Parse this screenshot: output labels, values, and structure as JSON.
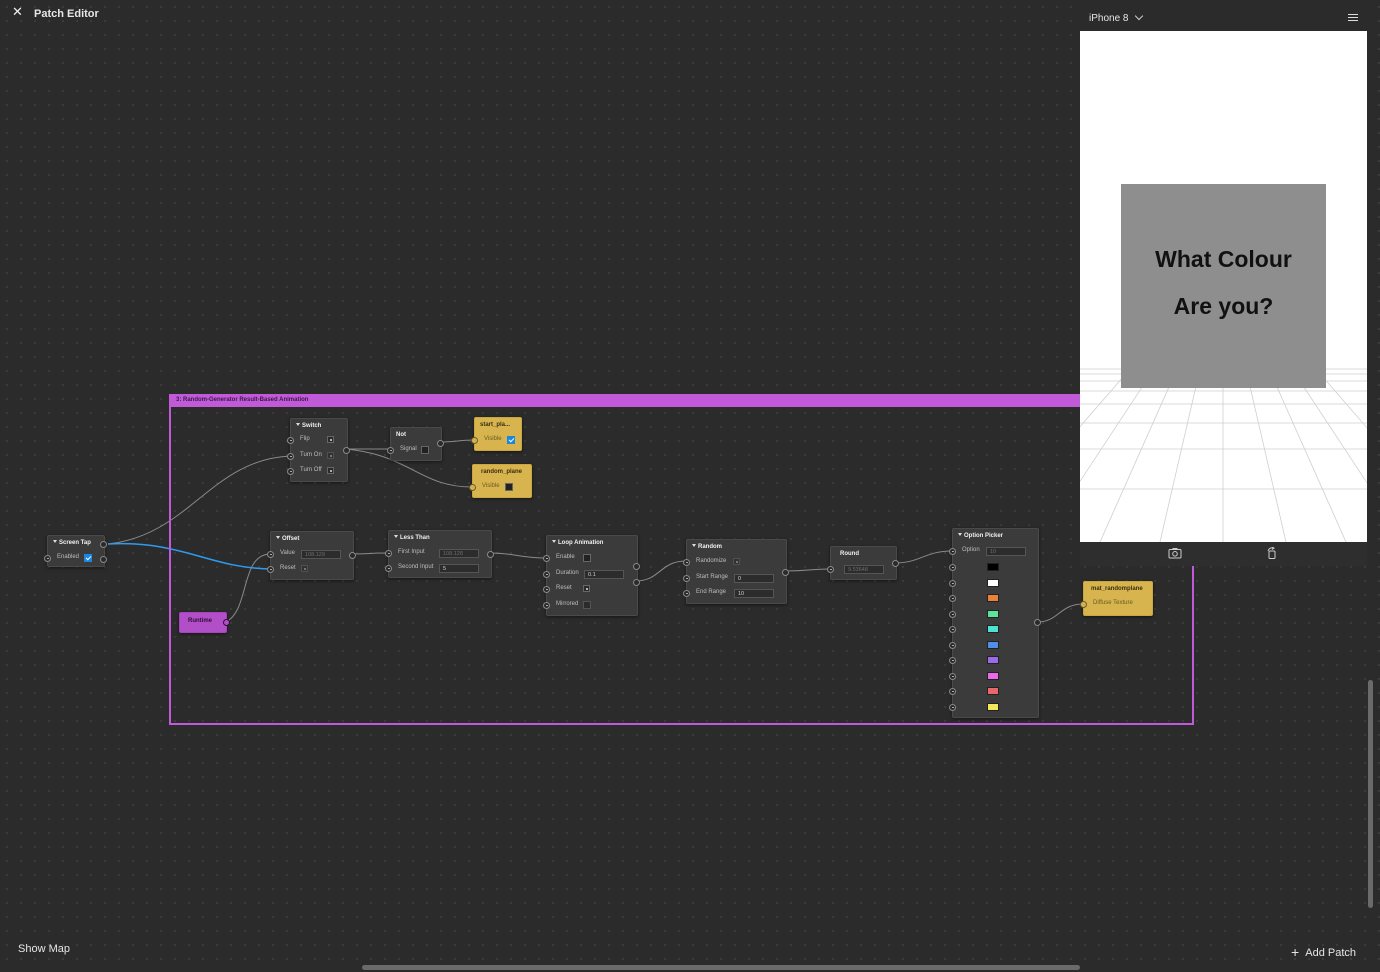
{
  "header": {
    "close_icon": "close-icon",
    "title": "Patch Editor"
  },
  "footer": {
    "show_map": "Show Map",
    "add_patch": "Add Patch"
  },
  "group": {
    "title": "3: Random-Generator Result-Based Animation",
    "color": "#c15ad8"
  },
  "nodes": {
    "screen_tap": {
      "title": "Screen Tap",
      "enabled_label": "Enabled",
      "enabled": true
    },
    "switch": {
      "title": "Switch",
      "flip": "Flip",
      "turn_on": "Turn On",
      "turn_off": "Turn Off"
    },
    "not": {
      "title": "Not",
      "signal": "Signal"
    },
    "start_plane": {
      "title": "start_pla...",
      "visible_label": "Visible",
      "visible": true
    },
    "random_plane": {
      "title": "random_plane",
      "visible_label": "Visible",
      "visible": false
    },
    "offset": {
      "title": "Offset",
      "value_label": "Value",
      "value": "108.129",
      "reset_label": "Reset"
    },
    "runtime": {
      "title": "Runtime"
    },
    "less_than": {
      "title": "Less Than",
      "first_input_label": "First Input",
      "first_input": "108.128",
      "second_input_label": "Second Input",
      "second_input": "5"
    },
    "loop_animation": {
      "title": "Loop Animation",
      "enable": "Enable",
      "duration_label": "Duration",
      "duration": "0.1",
      "reset": "Reset",
      "mirrored": "Mirrored"
    },
    "random": {
      "title": "Random",
      "randomize": "Randomize",
      "start_range_label": "Start Range",
      "start_range": "0",
      "end_range_label": "End Range",
      "end_range": "10"
    },
    "round": {
      "title": "Round",
      "value": "9.53648"
    },
    "option_picker": {
      "title": "Option Picker",
      "option_label": "Option",
      "option": "10",
      "swatches": [
        "#000000",
        "#ffffff",
        "#e8823a",
        "#5fe39a",
        "#4ee3d0",
        "#4f8fe8",
        "#9a6ae8",
        "#e86ae8",
        "#e8686a",
        "#f2e85a"
      ]
    },
    "mat_randomplane": {
      "title": "mat_randomplane",
      "texture_label": "Diffuse Texture"
    }
  },
  "preview": {
    "device": "iPhone 8",
    "plane_line1": "What Colour",
    "plane_line2": "Are you?"
  },
  "colors": {
    "wire": "#8a8a8a",
    "wire_active": "#2e9bf0",
    "patch_yellow": "#d7b44e",
    "patch_purple": "#b34ec9"
  }
}
